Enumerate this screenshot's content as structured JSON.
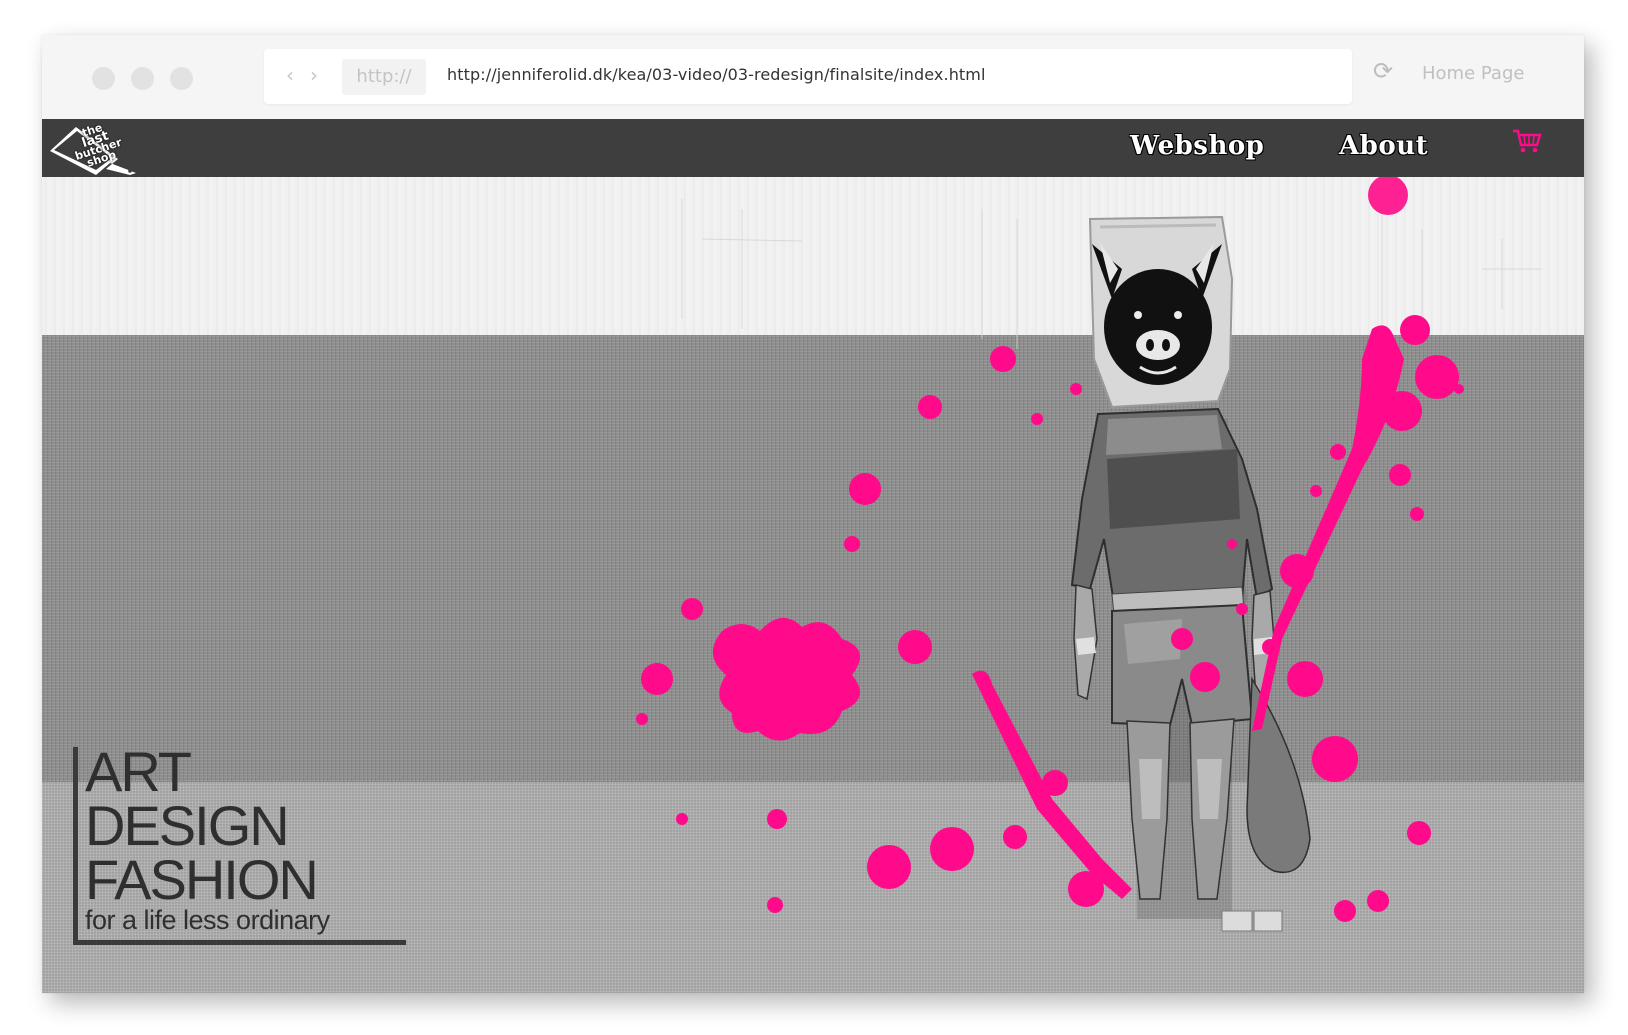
{
  "browser": {
    "protocol_label": "http://",
    "url": "http://jenniferolid.dk/kea/03-video/03-redesign/finalsite/index.html",
    "home_label": "Home Page"
  },
  "site": {
    "logo_text": [
      "the",
      "last",
      "butcher",
      "shop"
    ],
    "nav": {
      "webshop": "Webshop",
      "about": "About"
    },
    "tagline": {
      "line1": "ART",
      "line2": "DESIGN",
      "line3": "FASHION",
      "line4": "for a life less ordinary"
    }
  },
  "colors": {
    "accent_pink": "#ff0a8a",
    "navbar": "#3e3e3e"
  },
  "icons": {
    "back": "chevron-left-icon",
    "forward": "chevron-right-icon",
    "reload": "reload-icon",
    "cart": "shopping-cart-icon",
    "logo": "cleaver-icon",
    "pig": "pig-head-icon"
  }
}
